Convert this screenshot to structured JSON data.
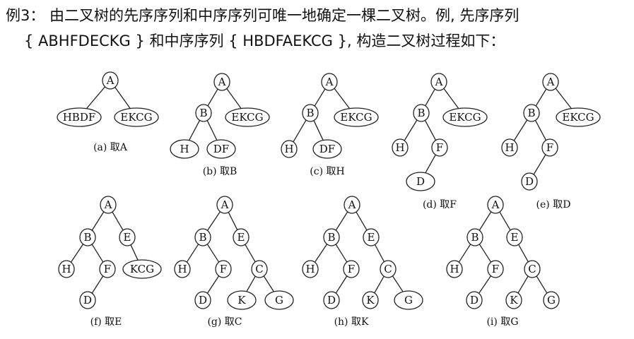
{
  "header": {
    "line1": "例3： 由二叉树的先序序列和中序序列可唯一地确定一棵二叉树。例, 先序序列",
    "line2": "{ ABHFDECKG } 和中序序列 { HBDFAEKCG }, 构造二叉树过程如下："
  },
  "panels": [
    {
      "id": "a",
      "caption": "(a) 取A",
      "nodes": [
        {
          "id": "n1",
          "label": "A",
          "shape": "circle"
        },
        {
          "id": "n2",
          "label": "HBDF",
          "shape": "ellipse"
        },
        {
          "id": "n3",
          "label": "EKCG",
          "shape": "ellipse"
        }
      ],
      "edges": [
        [
          "n1",
          "n2"
        ],
        [
          "n1",
          "n3"
        ]
      ]
    },
    {
      "id": "b",
      "caption": "(b) 取B",
      "nodes": [
        {
          "id": "n1",
          "label": "A",
          "shape": "circle"
        },
        {
          "id": "n2",
          "label": "B",
          "shape": "circle"
        },
        {
          "id": "n3",
          "label": "EKCG",
          "shape": "ellipse"
        },
        {
          "id": "n4",
          "label": "H",
          "shape": "ellipse"
        },
        {
          "id": "n5",
          "label": "DF",
          "shape": "ellipse"
        }
      ],
      "edges": [
        [
          "n1",
          "n2"
        ],
        [
          "n1",
          "n3"
        ],
        [
          "n2",
          "n4"
        ],
        [
          "n2",
          "n5"
        ]
      ]
    },
    {
      "id": "c",
      "caption": "(c) 取H",
      "nodes": [
        {
          "id": "n1",
          "label": "A",
          "shape": "circle"
        },
        {
          "id": "n2",
          "label": "B",
          "shape": "circle"
        },
        {
          "id": "n3",
          "label": "EKCG",
          "shape": "ellipse"
        },
        {
          "id": "n4",
          "label": "H",
          "shape": "circle"
        },
        {
          "id": "n5",
          "label": "DF",
          "shape": "ellipse"
        }
      ],
      "edges": [
        [
          "n1",
          "n2"
        ],
        [
          "n1",
          "n3"
        ],
        [
          "n2",
          "n4"
        ],
        [
          "n2",
          "n5"
        ]
      ]
    },
    {
      "id": "d",
      "caption": "(d) 取F",
      "nodes": [
        {
          "id": "n1",
          "label": "A",
          "shape": "circle"
        },
        {
          "id": "n2",
          "label": "B",
          "shape": "circle"
        },
        {
          "id": "n3",
          "label": "EKCG",
          "shape": "ellipse"
        },
        {
          "id": "n4",
          "label": "H",
          "shape": "circle"
        },
        {
          "id": "n5",
          "label": "F",
          "shape": "circle"
        },
        {
          "id": "n6",
          "label": "D",
          "shape": "ellipse"
        }
      ],
      "edges": [
        [
          "n1",
          "n2"
        ],
        [
          "n1",
          "n3"
        ],
        [
          "n2",
          "n4"
        ],
        [
          "n2",
          "n5"
        ],
        [
          "n5",
          "n6"
        ]
      ]
    },
    {
      "id": "e",
      "caption": "(e) 取D",
      "nodes": [
        {
          "id": "n1",
          "label": "A",
          "shape": "circle"
        },
        {
          "id": "n2",
          "label": "B",
          "shape": "circle"
        },
        {
          "id": "n3",
          "label": "EKCG",
          "shape": "ellipse"
        },
        {
          "id": "n4",
          "label": "H",
          "shape": "circle"
        },
        {
          "id": "n5",
          "label": "F",
          "shape": "circle"
        },
        {
          "id": "n6",
          "label": "D",
          "shape": "circle"
        }
      ],
      "edges": [
        [
          "n1",
          "n2"
        ],
        [
          "n1",
          "n3"
        ],
        [
          "n2",
          "n4"
        ],
        [
          "n2",
          "n5"
        ],
        [
          "n5",
          "n6"
        ]
      ]
    },
    {
      "id": "f",
      "caption": "(f) 取E",
      "nodes": [
        {
          "id": "n1",
          "label": "A",
          "shape": "circle"
        },
        {
          "id": "n2",
          "label": "B",
          "shape": "circle"
        },
        {
          "id": "n3",
          "label": "E",
          "shape": "circle"
        },
        {
          "id": "n4",
          "label": "H",
          "shape": "circle"
        },
        {
          "id": "n5",
          "label": "F",
          "shape": "circle"
        },
        {
          "id": "n6",
          "label": "KCG",
          "shape": "ellipse"
        },
        {
          "id": "n7",
          "label": "D",
          "shape": "circle"
        }
      ],
      "edges": [
        [
          "n1",
          "n2"
        ],
        [
          "n1",
          "n3"
        ],
        [
          "n2",
          "n4"
        ],
        [
          "n2",
          "n5"
        ],
        [
          "n3",
          "n6"
        ],
        [
          "n5",
          "n7"
        ]
      ]
    },
    {
      "id": "g",
      "caption": "(g) 取C",
      "nodes": [
        {
          "id": "n1",
          "label": "A",
          "shape": "circle"
        },
        {
          "id": "n2",
          "label": "B",
          "shape": "circle"
        },
        {
          "id": "n3",
          "label": "E",
          "shape": "circle"
        },
        {
          "id": "n4",
          "label": "H",
          "shape": "circle"
        },
        {
          "id": "n5",
          "label": "F",
          "shape": "circle"
        },
        {
          "id": "n6",
          "label": "C",
          "shape": "circle"
        },
        {
          "id": "n7",
          "label": "D",
          "shape": "circle"
        },
        {
          "id": "n8",
          "label": "K",
          "shape": "ellipse"
        },
        {
          "id": "n9",
          "label": "G",
          "shape": "ellipse"
        }
      ],
      "edges": [
        [
          "n1",
          "n2"
        ],
        [
          "n1",
          "n3"
        ],
        [
          "n2",
          "n4"
        ],
        [
          "n2",
          "n5"
        ],
        [
          "n3",
          "n6"
        ],
        [
          "n5",
          "n7"
        ],
        [
          "n6",
          "n8"
        ],
        [
          "n6",
          "n9"
        ]
      ]
    },
    {
      "id": "h",
      "caption": "(h) 取K",
      "nodes": [
        {
          "id": "n1",
          "label": "A",
          "shape": "circle"
        },
        {
          "id": "n2",
          "label": "B",
          "shape": "circle"
        },
        {
          "id": "n3",
          "label": "E",
          "shape": "circle"
        },
        {
          "id": "n4",
          "label": "H",
          "shape": "circle"
        },
        {
          "id": "n5",
          "label": "F",
          "shape": "circle"
        },
        {
          "id": "n6",
          "label": "C",
          "shape": "circle"
        },
        {
          "id": "n7",
          "label": "D",
          "shape": "circle"
        },
        {
          "id": "n8",
          "label": "K",
          "shape": "circle"
        },
        {
          "id": "n9",
          "label": "G",
          "shape": "ellipse"
        }
      ],
      "edges": [
        [
          "n1",
          "n2"
        ],
        [
          "n1",
          "n3"
        ],
        [
          "n2",
          "n4"
        ],
        [
          "n2",
          "n5"
        ],
        [
          "n3",
          "n6"
        ],
        [
          "n5",
          "n7"
        ],
        [
          "n6",
          "n8"
        ],
        [
          "n6",
          "n9"
        ]
      ]
    },
    {
      "id": "i",
      "caption": "(i) 取G",
      "nodes": [
        {
          "id": "n1",
          "label": "A",
          "shape": "circle"
        },
        {
          "id": "n2",
          "label": "B",
          "shape": "circle"
        },
        {
          "id": "n3",
          "label": "E",
          "shape": "circle"
        },
        {
          "id": "n4",
          "label": "H",
          "shape": "circle"
        },
        {
          "id": "n5",
          "label": "F",
          "shape": "circle"
        },
        {
          "id": "n6",
          "label": "C",
          "shape": "circle"
        },
        {
          "id": "n7",
          "label": "D",
          "shape": "circle"
        },
        {
          "id": "n8",
          "label": "K",
          "shape": "circle"
        },
        {
          "id": "n9",
          "label": "G",
          "shape": "circle"
        }
      ],
      "edges": [
        [
          "n1",
          "n2"
        ],
        [
          "n1",
          "n3"
        ],
        [
          "n2",
          "n4"
        ],
        [
          "n2",
          "n5"
        ],
        [
          "n3",
          "n6"
        ],
        [
          "n5",
          "n7"
        ],
        [
          "n6",
          "n8"
        ],
        [
          "n6",
          "n9"
        ]
      ]
    }
  ]
}
